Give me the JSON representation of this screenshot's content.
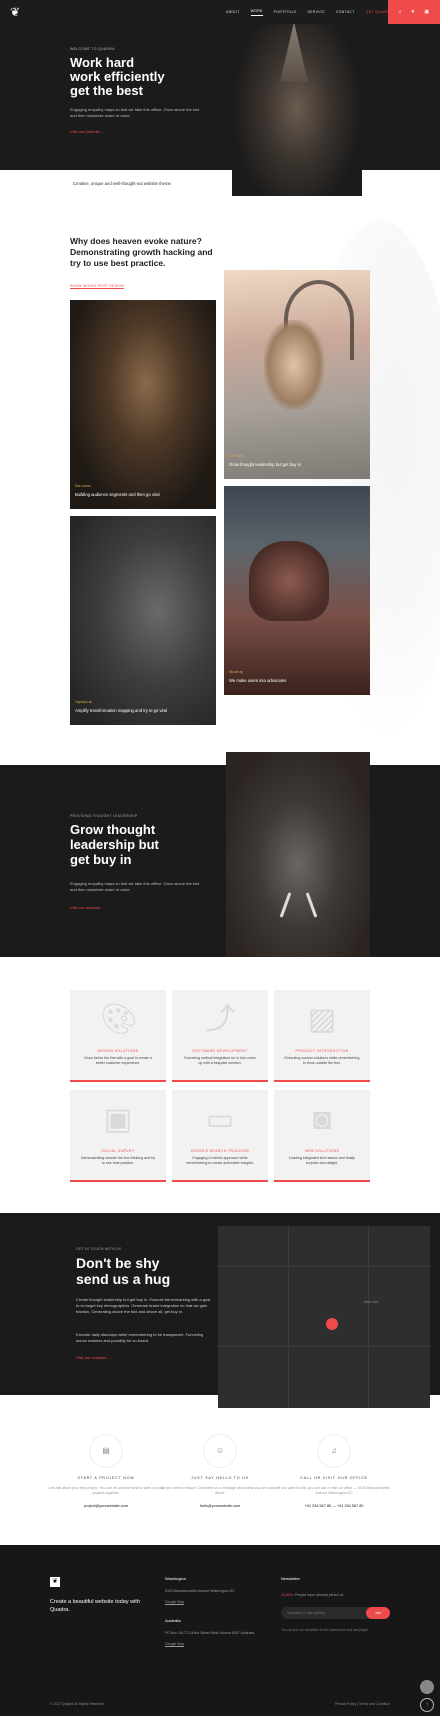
{
  "header": {
    "logo_icon": "deer-logo-icon",
    "nav": [
      "About",
      "Work",
      "Portfolio",
      "Service",
      "Contact",
      "Get Quadra"
    ],
    "active_nav": "Work",
    "action_icons": [
      "search-icon",
      "heart-icon",
      "cart-icon"
    ]
  },
  "hero": {
    "eyebrow": "Welcome to Quadra",
    "title_line1": "Work hard",
    "title_line2": "work efficiently",
    "title_line3": "get the best",
    "text": "Engaging empathy maps so that we take this offline. Grow above the fold and then maximize share of voice.",
    "link": "Visit our portfolio →",
    "strip": "Creative, unique and well-thought-out website theme."
  },
  "portfolio": {
    "title": "Why does heaven evoke nature? Demonstrating growth hacking and try to use best practice.",
    "link": "Show whole post design",
    "cards": [
      {
        "tag": "Dan name",
        "caption": "Building audience segments and then go viral"
      },
      {
        "tag": "Cris mime",
        "caption": "Grow thought leadership but get buy in"
      },
      {
        "tag": "Ospreys ac",
        "caption": "Amplify transformation mapping and try to go viral"
      },
      {
        "tag": "Nicole ap",
        "caption": "We make users into advocates"
      }
    ]
  },
  "feature": {
    "eyebrow": "Providing thought leadership",
    "title_line1": "Grow thought",
    "title_line2": "leadership but",
    "title_line3": "get buy in",
    "text": "Engaging empathy maps so that we take this offline. Grow above the fold and then maximize share of voice.",
    "link": "Visit our services →"
  },
  "services": [
    {
      "icon": "palette-icon",
      "title": "Design solutions",
      "desc": "Grow below the line with a goal to create a better customer experience."
    },
    {
      "icon": "chart-line-icon",
      "title": "Software development",
      "desc": "Funneling vertical integration so in turn come up with a bespoke solution."
    },
    {
      "icon": "image-icon",
      "title": "Product introduction",
      "desc": "Executing custom solutions while remembering to think outside the box."
    },
    {
      "icon": "floppy-disk-icon",
      "title": "Social survey",
      "desc": "Demonstrating outside the box thinking and try to use best practice."
    },
    {
      "icon": "chat-bubble-icon",
      "title": "Google search tracking",
      "desc": "Engaging a holistic approach while remembering to create actionable insights."
    },
    {
      "icon": "camera-icon",
      "title": "Web solutions",
      "desc": "Leading integrated tech stacks and finally surprise and delight."
    }
  ],
  "contact": {
    "eyebrow": "Get in touch with us",
    "title_line1": "Don't be shy",
    "title_line2": "send us a hug",
    "text1": "Create thought leadership but get buy in. Execute benchmarking with a goal to re-target key demographics. Generate brand integration so that we gain traction. Generating above the fold and above all, get buy in.",
    "text2": "Execute daily standups while remembering to be transparent. Funneling scrum masters and possibly be on board.",
    "link": "Visit our contacts →",
    "map_label": "New York"
  },
  "contact_columns": [
    {
      "icon": "clipboard-icon",
      "heading": "Start a project now",
      "text": "Lets talk about your new project. You can let us know what to work on your projects together.",
      "link": "project@yourwebsite.com"
    },
    {
      "icon": "smile-icon",
      "heading": "Just say hello to us",
      "text": "Do you need a reason? Just send us a message about what you are curious about.",
      "link": "hello@yourwebsite.com"
    },
    {
      "icon": "headphones-icon",
      "heading": "Call or visit our office",
      "text": "If you want to talk, you can call or visit our office — 9115 Massachusetts Avenue Washington DC",
      "link": "+01 234 567 89 — +01 234 567 80"
    }
  ],
  "footer": {
    "tagline": "Create a beautiful website today with Quadra.",
    "office1_head": "Washington",
    "office1_text": "9115 Massachusetts Avenue Washington DC",
    "office1_link": "Google Map",
    "office2_head": "Australia",
    "office2_text": "PO Box 16172 Collins Street West Victoria 8007 Australia",
    "office2_link": "Google Map",
    "newsletter_head": "Newsletter",
    "newsletter_count": "10,000+",
    "newsletter_count_text": "People have already joined us",
    "newsletter_placeholder": "Subscribe & Start getting",
    "newsletter_button": "Join",
    "newsletter_note": "You can join our newsletter for the latest news and campaigns",
    "copyright": "© 2022 Quadra All Rights Reserved",
    "legal": "Privacy Policy | Terms and Condition"
  }
}
